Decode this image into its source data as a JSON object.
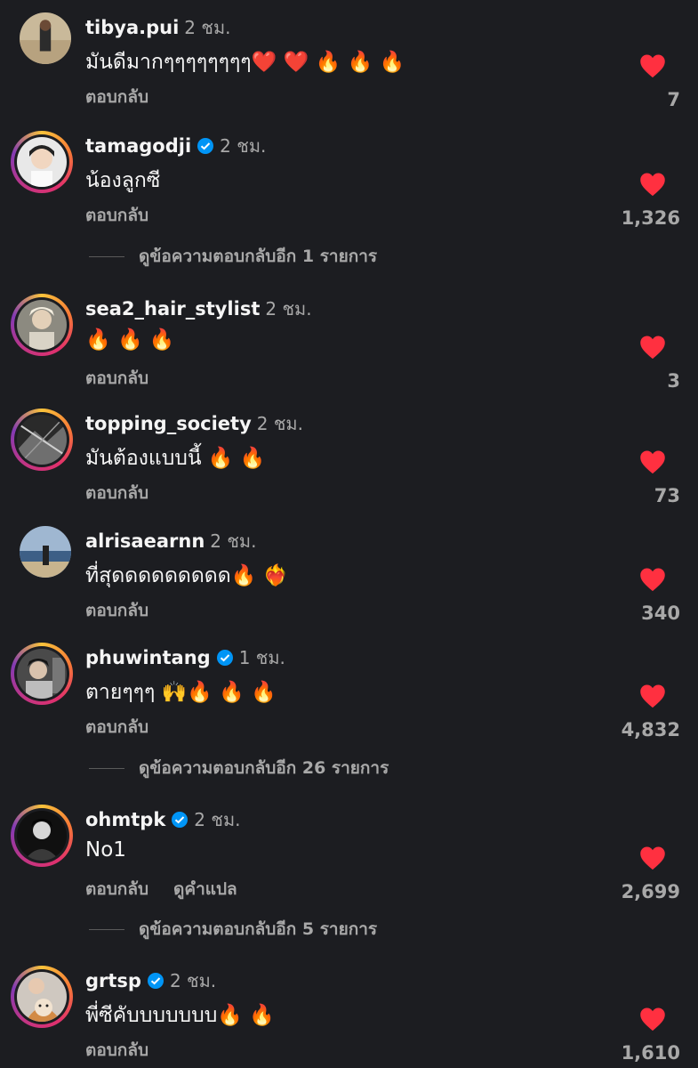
{
  "comments": [
    {
      "username": "tibya.pui",
      "verified": false,
      "time": "2 ชม.",
      "text": "มันดีมากๆๆๆๆๆๆๆๆ❤️ ❤️ 🔥 🔥 🔥",
      "reply": "ตอบกลับ",
      "likes": "7"
    },
    {
      "username": "tamagodji",
      "verified": true,
      "time": "2 ชม.",
      "text": "น้องลูกซี",
      "reply": "ตอบกลับ",
      "likes": "1,326",
      "view_replies": "ดูข้อความตอบกลับอีก 1 รายการ"
    },
    {
      "username": "sea2_hair_stylist",
      "verified": false,
      "time": "2 ชม.",
      "text": "🔥 🔥 🔥",
      "reply": "ตอบกลับ",
      "likes": "3"
    },
    {
      "username": "topping_society",
      "verified": false,
      "time": "2 ชม.",
      "text": "มันต้องแบบนี้ 🔥 🔥",
      "reply": "ตอบกลับ",
      "likes": "73"
    },
    {
      "username": "alrisaearnn",
      "verified": false,
      "time": "2 ชม.",
      "text": "ที่สุดดดดดดดดด🔥 ❤️‍🔥",
      "reply": "ตอบกลับ",
      "likes": "340"
    },
    {
      "username": "phuwintang",
      "verified": true,
      "time": "1 ชม.",
      "text": "ตายๆๆๆ 🙌🔥 🔥 🔥",
      "reply": "ตอบกลับ",
      "likes": "4,832",
      "view_replies": "ดูข้อความตอบกลับอีก 26 รายการ"
    },
    {
      "username": "ohmtpk",
      "verified": true,
      "time": "2 ชม.",
      "text": "No1",
      "reply": "ตอบกลับ",
      "translate": "ดูคำแปล",
      "likes": "2,699",
      "view_replies": "ดูข้อความตอบกลับอีก 5 รายการ"
    },
    {
      "username": "grtsp",
      "verified": true,
      "time": "2 ชม.",
      "text": "พี่ซีคับบบบบบบ🔥 🔥",
      "reply": "ตอบกลับ",
      "likes": "1,610"
    }
  ],
  "colors": {
    "background": "#1c1d21",
    "heart": "#ff3040",
    "verified": "#0095f6",
    "muted": "#a8a8a8"
  },
  "icons": {
    "heart": "heart-icon",
    "verified": "verified-badge-icon"
  }
}
